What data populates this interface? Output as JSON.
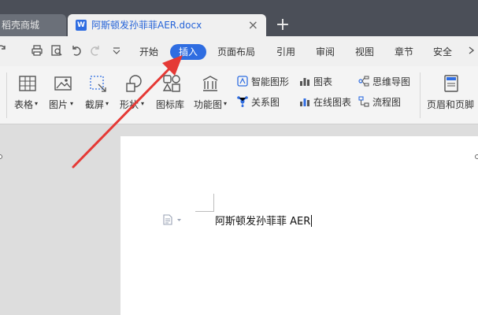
{
  "tabs": {
    "store_label": "稻壳商城",
    "doc_label": "阿斯顿发孙菲菲AER.docx",
    "doc_icon": "W",
    "close_glyph": "×",
    "new_tab_glyph": "+"
  },
  "menu": {
    "items": [
      "开始",
      "插入",
      "页面布局",
      "引用",
      "审阅",
      "视图",
      "章节",
      "安全"
    ],
    "active": "插入",
    "active_color": "#2f6de1"
  },
  "quick_access_icons": [
    "redo-icon",
    "print-icon",
    "print-preview-icon",
    "undo-icon",
    "redo-disabled-icon",
    "dropdown-icon"
  ],
  "ribbon": {
    "big_buttons": [
      {
        "label": "表格",
        "icon": "table-icon",
        "dropdown": true
      },
      {
        "label": "图片",
        "icon": "picture-icon",
        "dropdown": true
      },
      {
        "label": "截屏",
        "icon": "screenshot-icon",
        "dropdown": true
      },
      {
        "label": "形状",
        "icon": "shapes-icon",
        "dropdown": true
      },
      {
        "label": "图标库",
        "icon": "icon-library-icon",
        "dropdown": false
      },
      {
        "label": "功能图",
        "icon": "function-chart-icon",
        "dropdown": true
      },
      {
        "label": "页眉和页脚",
        "icon": "header-footer-icon",
        "dropdown": false
      }
    ],
    "small_buttons": [
      {
        "label": "智能图形",
        "icon": "smartart-icon"
      },
      {
        "label": "关系图",
        "icon": "relation-chart-icon"
      },
      {
        "label": "图表",
        "icon": "chart-icon"
      },
      {
        "label": "在线图表",
        "icon": "online-chart-icon"
      },
      {
        "label": "思维导图",
        "icon": "mindmap-icon"
      },
      {
        "label": "流程图",
        "icon": "flowchart-icon"
      }
    ]
  },
  "document": {
    "text": "阿斯顿发孙菲菲 AER"
  },
  "annotation": {
    "arrow_color": "#e53935"
  }
}
